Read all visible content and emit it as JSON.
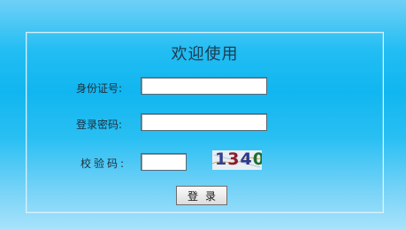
{
  "form": {
    "title": "欢迎使用",
    "id_label": "身份证号:",
    "id_value": "",
    "password_label": "登录密码:",
    "password_value": "",
    "code_label": "校验码:",
    "code_value": "",
    "captcha_digits": [
      "1",
      "3",
      "4",
      "0"
    ],
    "login_label": "登录"
  }
}
